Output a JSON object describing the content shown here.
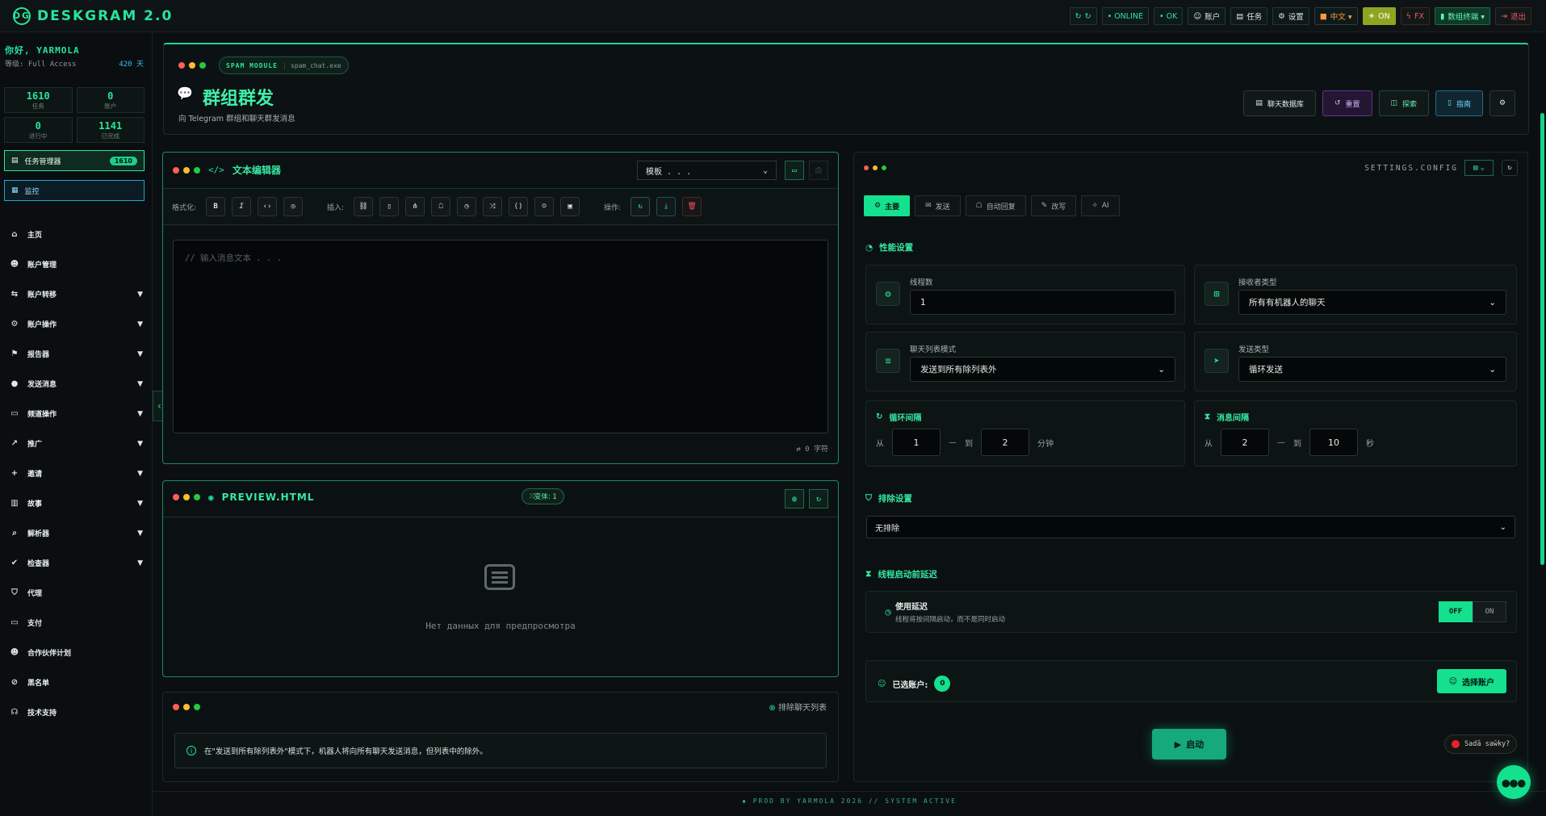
{
  "topbar": {
    "logo": "DESKGRAM 2.0",
    "buttons": [
      {
        "label": "↻",
        "icon": "refresh-icon",
        "style": "g"
      },
      {
        "label": "• ONLINE",
        "icon": "status-icon",
        "style": "g"
      },
      {
        "label": "• OK",
        "icon": "ok-icon",
        "style": "g"
      },
      {
        "label": "账户",
        "icon": "user-icon",
        "style": ""
      },
      {
        "label": "任务",
        "icon": "task-icon",
        "style": ""
      },
      {
        "label": "设置",
        "icon": "gear-icon",
        "style": ""
      },
      {
        "label": "中文 ▾",
        "icon": "flag-cn-icon",
        "style": "cn"
      },
      {
        "label": "ON",
        "icon": "sun-icon",
        "style": "yel"
      },
      {
        "label": "FX",
        "icon": "bolt-icon",
        "style": "r"
      },
      {
        "label": "数组终端 ▾",
        "icon": "terminal-icon",
        "style": "green2"
      },
      {
        "label": "退出",
        "icon": "logout-icon",
        "style": "r"
      }
    ]
  },
  "sidebar": {
    "greeting": "你好, YARMOLA",
    "level_label": "等级: Full Access",
    "days": "420 天",
    "stats": [
      {
        "value": "1610",
        "label": "任务"
      },
      {
        "value": "0",
        "label": "账户"
      },
      {
        "value": "0",
        "label": "进行中"
      },
      {
        "value": "1141",
        "label": "已完成"
      }
    ],
    "task_manager": {
      "label": "任务管理器",
      "count": "1610"
    },
    "monitor": {
      "label": "监控"
    },
    "nav": [
      {
        "label": "主页",
        "icon": "home-icon",
        "chev": false
      },
      {
        "label": "账户管理",
        "icon": "users-icon",
        "chev": false
      },
      {
        "label": "账户转移",
        "icon": "user-transfer-icon",
        "chev": true
      },
      {
        "label": "账户操作",
        "icon": "user-cog-icon",
        "chev": true
      },
      {
        "label": "报告器",
        "icon": "flag-icon",
        "chev": true
      },
      {
        "label": "发送消息",
        "icon": "chat-icon",
        "chev": true
      },
      {
        "label": "频道操作",
        "icon": "broadcast-icon",
        "chev": true
      },
      {
        "label": "推广",
        "icon": "chart-icon",
        "chev": true
      },
      {
        "label": "邀请",
        "icon": "user-plus-icon",
        "chev": true
      },
      {
        "label": "故事",
        "icon": "story-icon",
        "chev": true
      },
      {
        "label": "解析器",
        "icon": "search-icon",
        "chev": true
      },
      {
        "label": "检查器",
        "icon": "check-icon",
        "chev": true
      },
      {
        "label": "代理",
        "icon": "shield-icon",
        "chev": false
      },
      {
        "label": "支付",
        "icon": "card-icon",
        "chev": false
      },
      {
        "label": "合作伙伴计划",
        "icon": "partners-icon",
        "chev": false
      },
      {
        "label": "黑名单",
        "icon": "user-block-icon",
        "chev": false
      },
      {
        "label": "技术支持",
        "icon": "headset-icon",
        "chev": false
      }
    ]
  },
  "header": {
    "module_name": "SPAM MODULE",
    "module_file": "spam_chat.exe",
    "title": "群组群发",
    "subtitle": "向 Telegram 群组和聊天群发消息",
    "buttons": [
      {
        "label": "聊天数据库",
        "icon": "database-icon",
        "style": ""
      },
      {
        "label": "重置",
        "icon": "reset-icon",
        "style": "p"
      },
      {
        "label": "探索",
        "icon": "explore-icon",
        "style": "g"
      },
      {
        "label": "指南",
        "icon": "book-icon",
        "style": "c"
      }
    ]
  },
  "editor": {
    "title": "文本编辑器",
    "template_placeholder": "模板 . . .",
    "format_label": "格式化:",
    "insert_label": "插入:",
    "actions_label": "操作:",
    "textarea_placeholder": "// 输入消息文本 . . .",
    "char_count": "0 字符"
  },
  "preview": {
    "title": "PREVIEW.HTML",
    "variants": "变体: 1",
    "empty_text": "Нет данных для предпросмотра"
  },
  "exclude": {
    "title": "排除聊天列表",
    "info": "在\"发送到所有除列表外\"模式下，机器人将向所有聊天发送消息，但列表中的除外。"
  },
  "settings": {
    "header": "SETTINGS.CONFIG",
    "tabs": [
      {
        "label": "主要",
        "icon": "gear-icon",
        "active": true
      },
      {
        "label": "发送",
        "icon": "send-icon",
        "active": false
      },
      {
        "label": "自动回复",
        "icon": "robot-icon",
        "active": false
      },
      {
        "label": "改写",
        "icon": "edit-icon",
        "active": false
      },
      {
        "label": "AI",
        "icon": "sparkle-icon",
        "active": false
      }
    ],
    "perf_title": "性能设置",
    "threads_label": "线程数",
    "threads_value": "1",
    "recipient_label": "接收者类型",
    "recipient_value": "所有有机器人的聊天",
    "list_mode_label": "聊天列表模式",
    "list_mode_value": "发送到所有除列表外",
    "send_type_label": "发送类型",
    "send_type_value": "循环发送",
    "cycle_title": "循环间隔",
    "cycle_from_label": "从",
    "cycle_from": "1",
    "cycle_to_label": "到",
    "cycle_to": "2",
    "cycle_unit": "分钟",
    "msg_title": "消息间隔",
    "msg_from_label": "从",
    "msg_from": "2",
    "msg_to_label": "到",
    "msg_to": "10",
    "msg_unit": "秒",
    "exclude_title": "排除设置",
    "exclude_value": "无排除",
    "delay_title": "线程启动前延迟",
    "delay_label": "使用延迟",
    "delay_desc": "线程将按间隔启动，而不是同时启动",
    "toggle_off": "OFF",
    "toggle_on": "ON",
    "selected_label": "已选账户:",
    "selected_count": "0",
    "select_button": "选择账户",
    "start_button": "启动"
  },
  "footer": "▪ PROD BY YARMOLA 2026   // SYSTEM ACTIVE",
  "recording": "Sadă saw̄ky?"
}
